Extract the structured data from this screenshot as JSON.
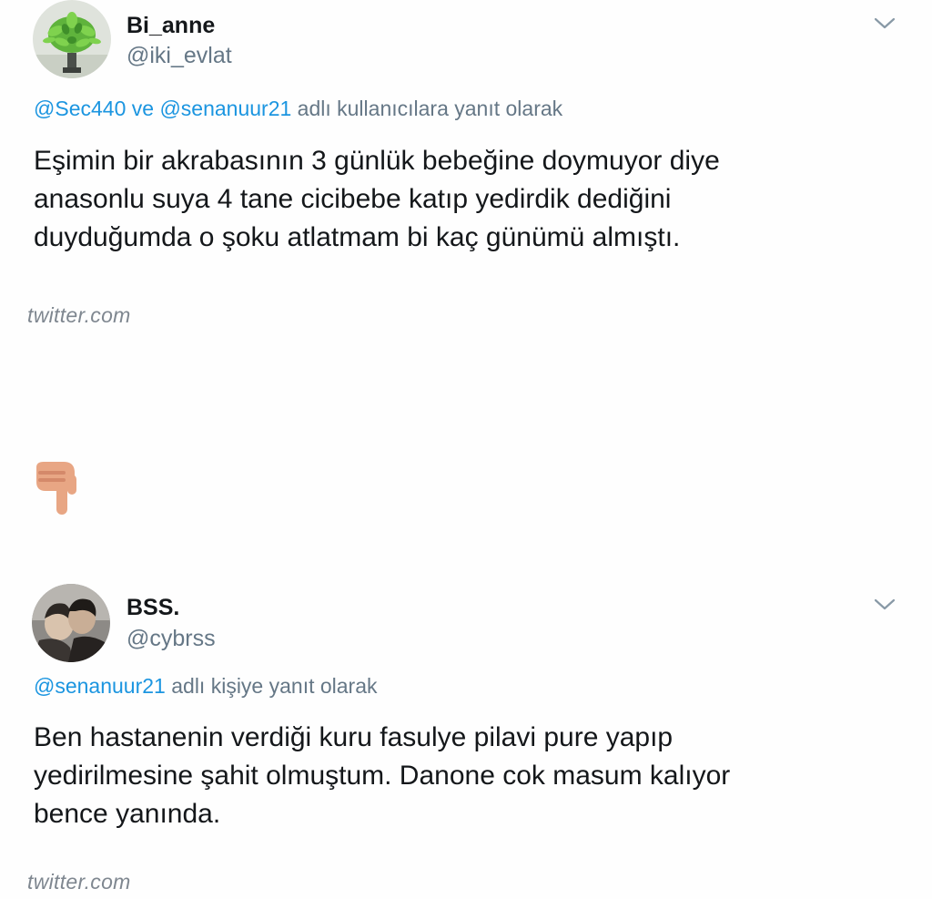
{
  "tweets": [
    {
      "display_name": "Bi_anne",
      "handle": "@iki_evlat",
      "avatar_icon": "potted-plant-avatar",
      "menu_icon": "chevron-down-icon",
      "reply": {
        "mention_1": "@Sec440",
        "connector": "ve",
        "mention_2": "@senanuur21",
        "suffix": "adlı kullanıcılara yanıt olarak"
      },
      "text_lines": [
        "Eşimin bir akrabasının 3 günlük bebeğine doymuyor diye",
        "anasonlu suya 4 tane cicibebe katıp yedirdik dediğini",
        "duyduğumda o şoku atlatmam bi kaç günümü almıştı."
      ],
      "watermark": "twitter.com"
    },
    {
      "display_name": "BSS.",
      "handle": "@cybrss",
      "avatar_icon": "couple-photo-avatar",
      "menu_icon": "chevron-down-icon",
      "reply": {
        "mention_1": "@senanuur21",
        "suffix": "adlı kişiye yanıt olarak"
      },
      "text_lines": [
        "Ben hastanenin verdiği kuru fasulye pilavi pure yapıp",
        "yedirilmesine şahit olmuştum. Danone cok masum kalıyor",
        "bence yanında."
      ],
      "watermark": "twitter.com"
    }
  ],
  "separator": {
    "icon": "backhand-index-pointing-down-icon",
    "color": "#e8a684"
  },
  "colors": {
    "text": "#14171a",
    "secondary": "#657786",
    "link": "#1b95e0",
    "watermark": "#7f8790"
  }
}
